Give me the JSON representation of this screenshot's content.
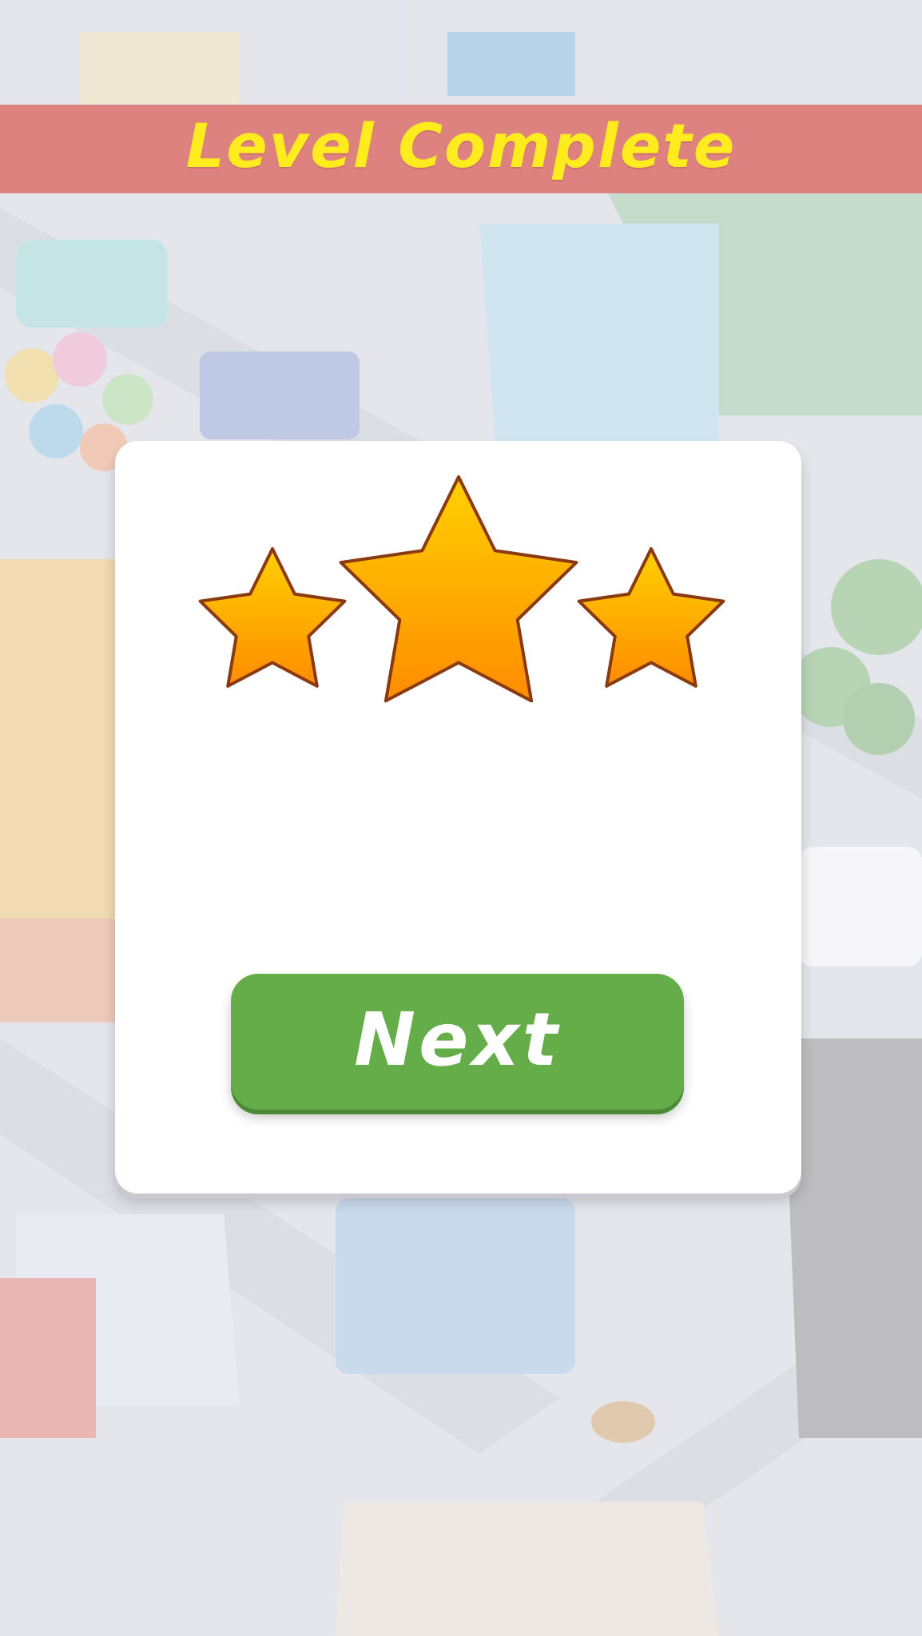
{
  "banner": {
    "title": "Level Complete"
  },
  "dialog": {
    "stars_earned": 3,
    "stars_total": 3,
    "star_color_top": "#ffd000",
    "star_color_bottom": "#ff8c00",
    "star_outline": "#8a3a12"
  },
  "next_button": {
    "label": "Next",
    "color": "#64ad48"
  },
  "colors": {
    "banner": "#de8280",
    "title": "#ffec1f",
    "card": "#ffffff"
  }
}
